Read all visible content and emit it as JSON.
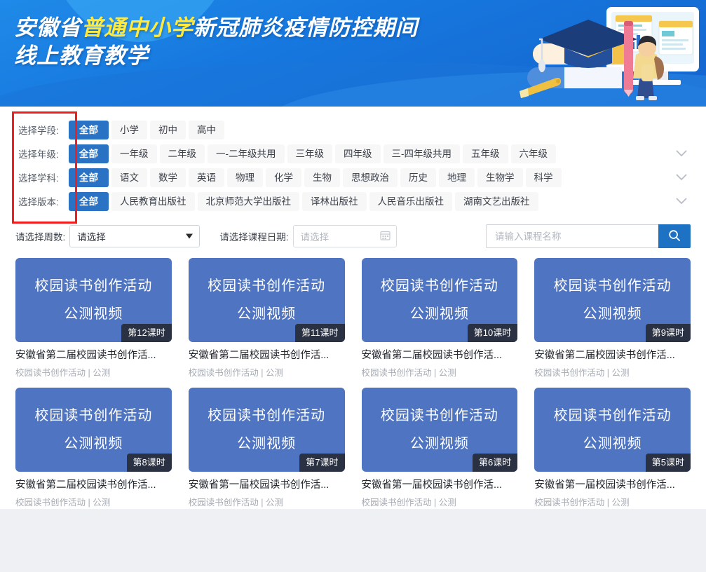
{
  "banner": {
    "title_line1_part1": "安徽省",
    "title_line1_highlight": "普通中小学",
    "title_line1_part2": "新冠肺炎疫情防控期间",
    "title_line2": "线上教育教学",
    "highlight_color": "#ffe93d",
    "background_color": "#1677de",
    "illustration": "student-books-monitor-illustration"
  },
  "filters": {
    "rows": [
      {
        "label": "选择学段:",
        "chips": [
          "全部",
          "小学",
          "初中",
          "高中"
        ],
        "active": "全部",
        "expandable": false
      },
      {
        "label": "选择年级:",
        "chips": [
          "全部",
          "一年级",
          "二年级",
          "一-二年级共用",
          "三年级",
          "四年级",
          "三-四年级共用",
          "五年级",
          "六年级"
        ],
        "active": "全部",
        "expandable": true
      },
      {
        "label": "选择学科:",
        "chips": [
          "全部",
          "语文",
          "数学",
          "英语",
          "物理",
          "化学",
          "生物",
          "思想政治",
          "历史",
          "地理",
          "生物学",
          "科学"
        ],
        "active": "全部",
        "expandable": true
      },
      {
        "label": "选择版本:",
        "chips": [
          "全部",
          "人民教育出版社",
          "北京师范大学出版社",
          "译林出版社",
          "人民音乐出版社",
          "湖南文艺出版社"
        ],
        "active": "全部",
        "expandable": true
      }
    ],
    "annotation_color": "#f01f1f",
    "active_chip_color": "#2a72c4"
  },
  "search": {
    "week_label": "请选择周数:",
    "week_value": "请选择",
    "date_label": "请选择课程日期:",
    "date_placeholder": "请选择",
    "keyword_placeholder": "请输入课程名称",
    "keyword_value": "",
    "search_icon": "search-icon",
    "search_button_color": "#1d72c4"
  },
  "courses": [
    {
      "thumb_line1": "校园读书创作活动",
      "thumb_line2": "公测视频",
      "badge": "第12课时",
      "title": "安徽省第二届校园读书创作活...",
      "meta": "校园读书创作活动 | 公测"
    },
    {
      "thumb_line1": "校园读书创作活动",
      "thumb_line2": "公测视频",
      "badge": "第11课时",
      "title": "安徽省第二届校园读书创作活...",
      "meta": "校园读书创作活动 | 公测"
    },
    {
      "thumb_line1": "校园读书创作活动",
      "thumb_line2": "公测视频",
      "badge": "第10课时",
      "title": "安徽省第二届校园读书创作活...",
      "meta": "校园读书创作活动 | 公测"
    },
    {
      "thumb_line1": "校园读书创作活动",
      "thumb_line2": "公测视频",
      "badge": "第9课时",
      "title": "安徽省第二届校园读书创作活...",
      "meta": "校园读书创作活动 | 公测"
    },
    {
      "thumb_line1": "校园读书创作活动",
      "thumb_line2": "公测视频",
      "badge": "第8课时",
      "title": "安徽省第二届校园读书创作活...",
      "meta": "校园读书创作活动 | 公测"
    },
    {
      "thumb_line1": "校园读书创作活动",
      "thumb_line2": "公测视频",
      "badge": "第7课时",
      "title": "安徽省第一届校园读书创作活...",
      "meta": "校园读书创作活动 | 公测"
    },
    {
      "thumb_line1": "校园读书创作活动",
      "thumb_line2": "公测视频",
      "badge": "第6课时",
      "title": "安徽省第一届校园读书创作活...",
      "meta": "校园读书创作活动 | 公测"
    },
    {
      "thumb_line1": "校园读书创作活动",
      "thumb_line2": "公测视频",
      "badge": "第5课时",
      "title": "安徽省第一届校园读书创作活...",
      "meta": "校园读书创作活动 | 公测"
    }
  ]
}
